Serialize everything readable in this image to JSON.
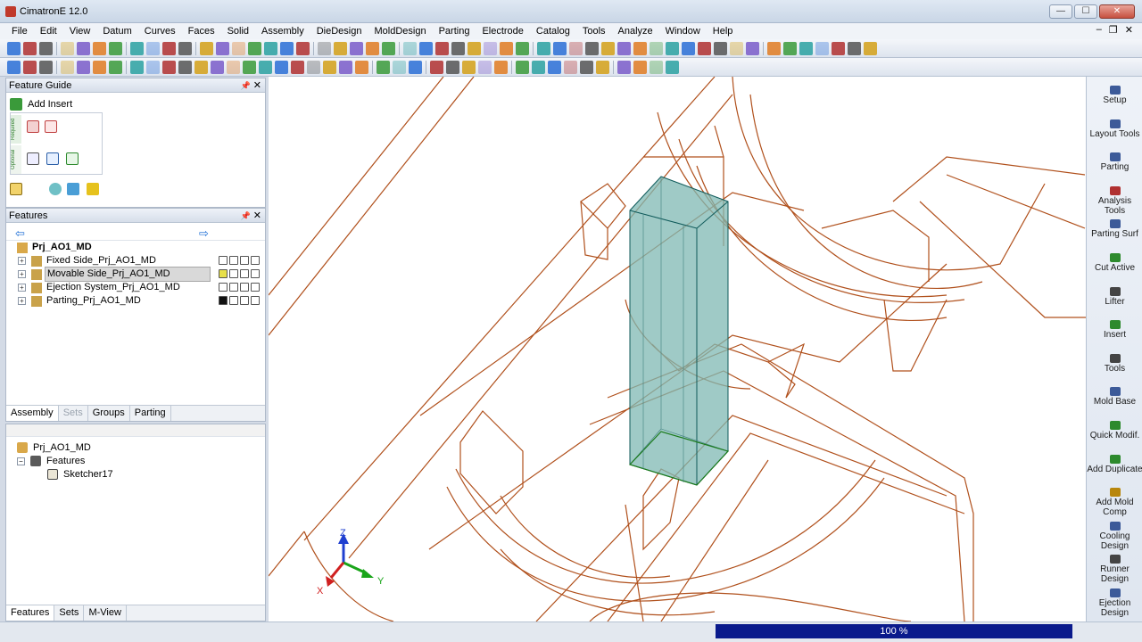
{
  "window": {
    "title": "CimatronE 12.0",
    "minimize": "—",
    "maximize": "☐",
    "close": "✕"
  },
  "menubar": [
    "File",
    "Edit",
    "View",
    "Datum",
    "Curves",
    "Faces",
    "Solid",
    "Assembly",
    "DieDesign",
    "MoldDesign",
    "Parting",
    "Electrode",
    "Catalog",
    "Tools",
    "Analyze",
    "Window",
    "Help"
  ],
  "mdi_controls": {
    "minimize": "–",
    "restore": "❐",
    "close": "✕"
  },
  "feature_guide": {
    "title": "Feature Guide",
    "add_insert": "Add Insert",
    "required_label": "Required",
    "optional_label": "Optional"
  },
  "features_panel": {
    "title": "Features",
    "back_arrow": "⇦",
    "forward_arrow": "⇨",
    "root": "Prj_AO1_MD",
    "items": [
      {
        "label": "Fixed Side_Prj_AO1_MD",
        "selected": false
      },
      {
        "label": "Movable Side_Prj_AO1_MD",
        "selected": true
      },
      {
        "label": "Ejection System_Prj_AO1_MD",
        "selected": false
      },
      {
        "label": "Parting_Prj_AO1_MD",
        "selected": false
      }
    ],
    "tabs": [
      "Assembly",
      "Sets",
      "Groups",
      "Parting"
    ]
  },
  "assembly_panel": {
    "root": "Prj_AO1_MD",
    "features_node": "Features",
    "sketcher": "Sketcher17",
    "tabs": [
      "Features",
      "Sets",
      "M-View"
    ]
  },
  "axes": {
    "z": "Z",
    "y": "Y",
    "x": "X"
  },
  "right_panel": [
    {
      "label": "Setup",
      "icon": "setup-icon"
    },
    {
      "label": "Layout Tools",
      "icon": "layout-tools-icon"
    },
    {
      "label": "Parting",
      "icon": "parting-icon"
    },
    {
      "label": "Analysis Tools",
      "icon": "analysis-tools-icon"
    },
    {
      "label": "Parting Surf",
      "icon": "parting-surf-icon"
    },
    {
      "label": "Cut Active",
      "icon": "cut-active-icon"
    },
    {
      "label": "Lifter",
      "icon": "lifter-icon"
    },
    {
      "label": "Insert",
      "icon": "insert-icon"
    },
    {
      "label": "Tools",
      "icon": "tools-icon"
    },
    {
      "label": "Mold Base",
      "icon": "mold-base-icon"
    },
    {
      "label": "Quick Modif.",
      "icon": "quick-modif-icon"
    },
    {
      "label": "Add Duplicate",
      "icon": "add-duplicate-icon"
    },
    {
      "label": "Add Mold Comp",
      "icon": "add-mold-comp-icon"
    },
    {
      "label": "Cooling Design",
      "icon": "cooling-design-icon"
    },
    {
      "label": "Runner Design",
      "icon": "runner-design-icon"
    },
    {
      "label": "Ejection Design",
      "icon": "ejection-design-icon"
    }
  ],
  "status": {
    "progress_text": "100 %",
    "progress_value": 1.0
  },
  "colors": {
    "wire": "#b0501c",
    "insert_fill": "#7fb8b3",
    "progress": "#0a1a8c"
  }
}
